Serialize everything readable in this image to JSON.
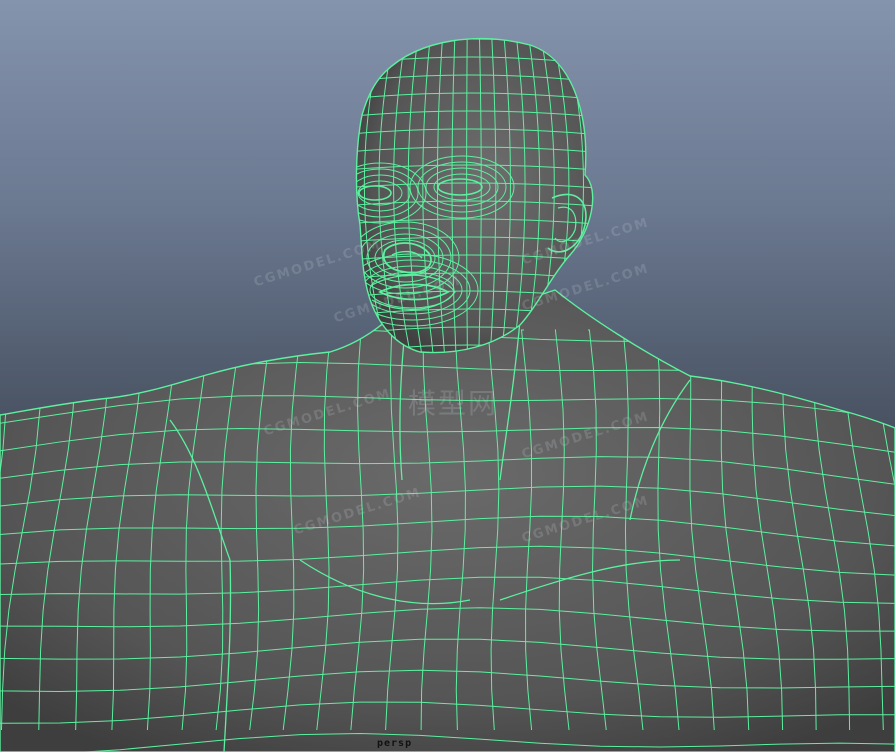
{
  "viewport": {
    "camera": "persp",
    "wire_color": "#5cf0a0",
    "surface_color": "#5e5e5e",
    "background_top": "#8494ac",
    "background_bottom": "#22262c"
  },
  "watermarks": {
    "site": "CGMODEL.COM",
    "site_cn": "模型网"
  }
}
